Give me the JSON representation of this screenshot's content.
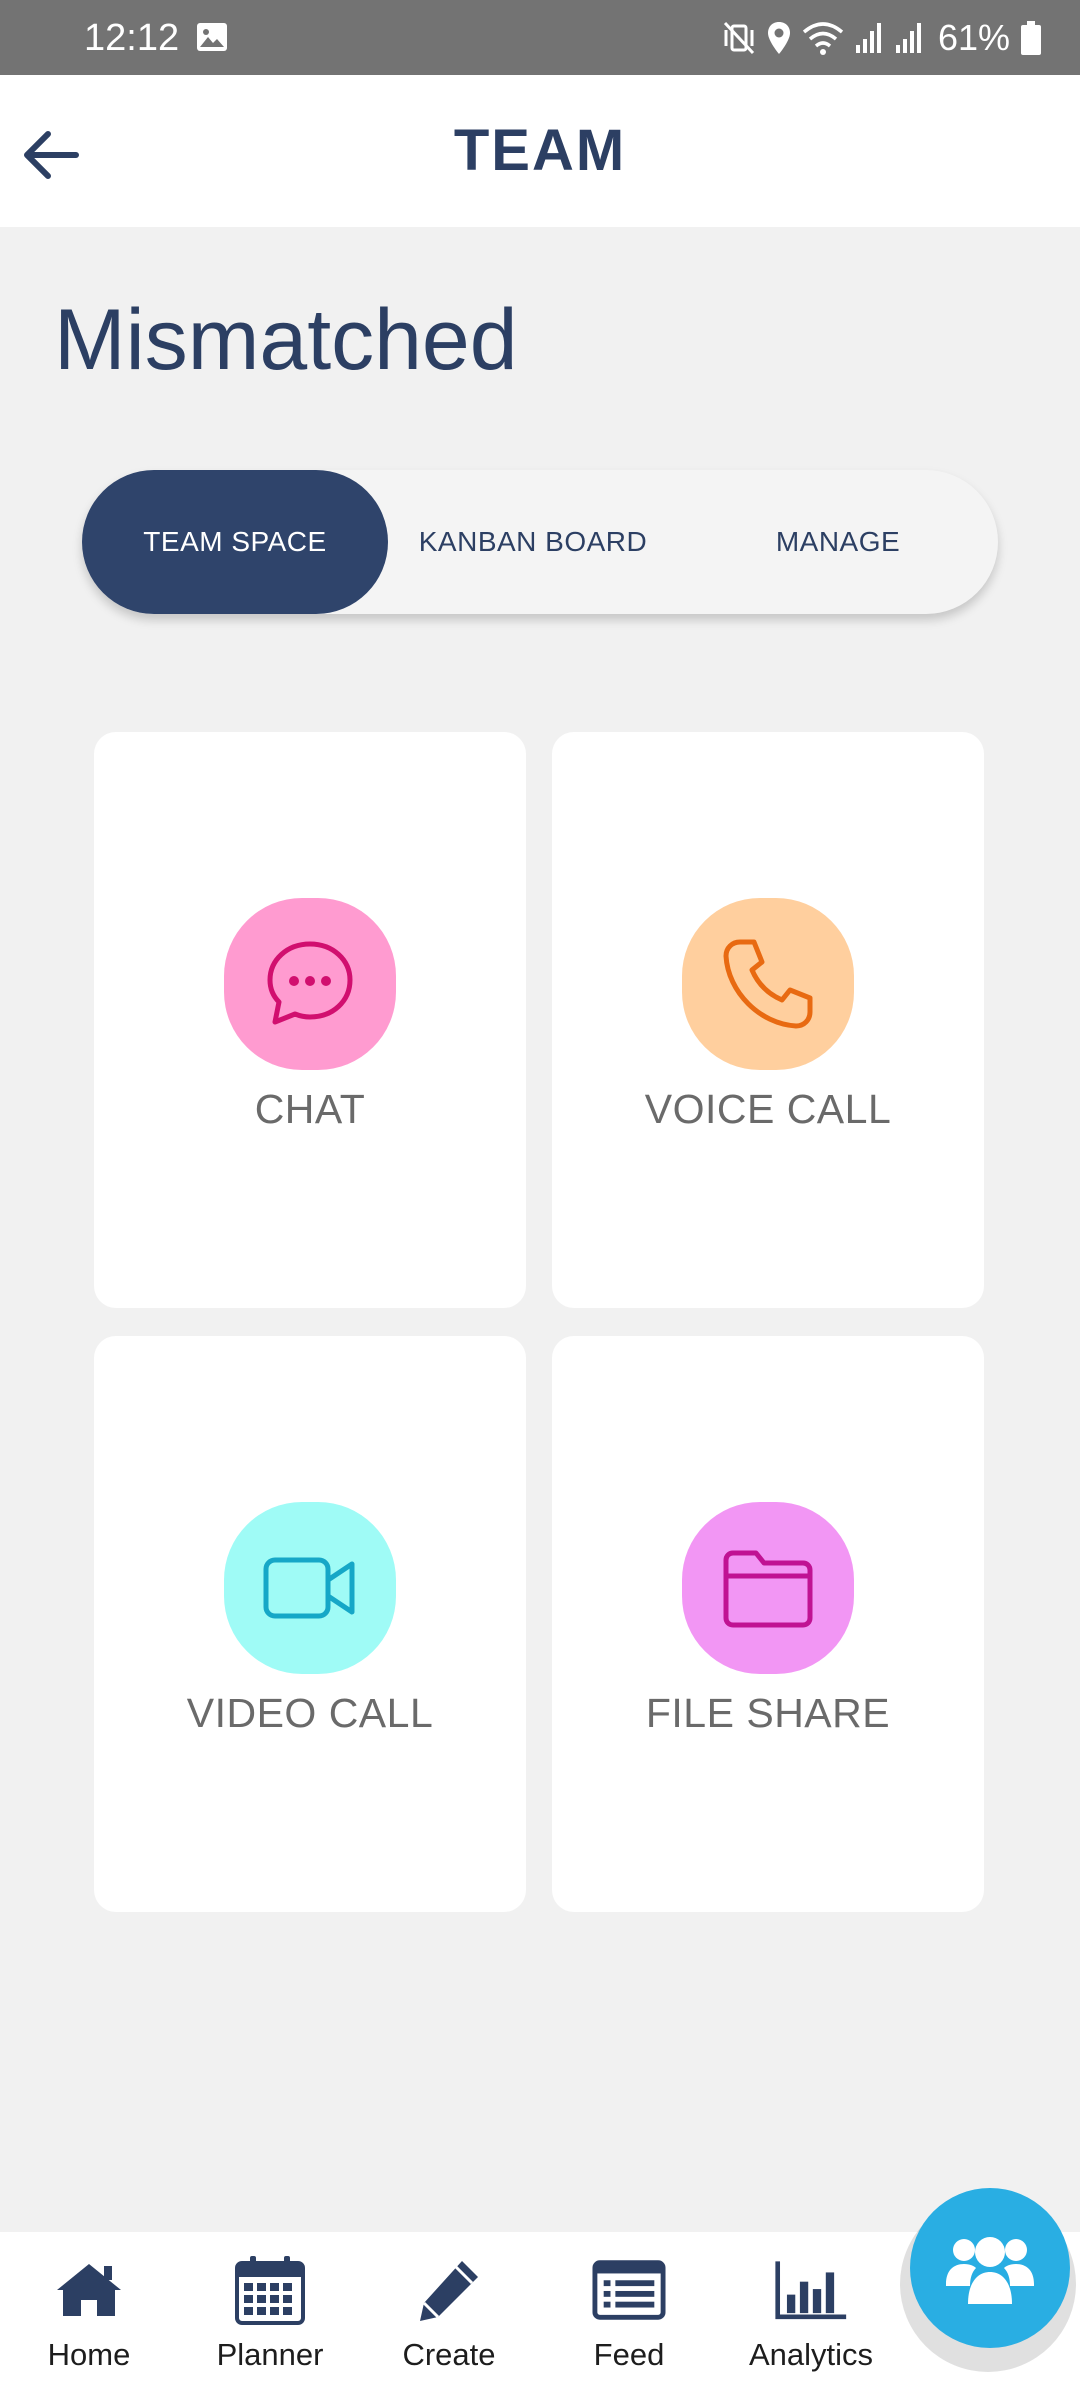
{
  "status_bar": {
    "time": "12:12",
    "battery": "61%"
  },
  "header": {
    "title": "TEAM"
  },
  "team": {
    "name": "Mismatched"
  },
  "tabs": [
    {
      "label": "TEAM SPACE",
      "active": true
    },
    {
      "label": "KANBAN BOARD",
      "active": false
    },
    {
      "label": "MANAGE",
      "active": false
    }
  ],
  "features": [
    {
      "label": "CHAT",
      "icon": "chat-bubble-icon",
      "bg": "#ff9bd0",
      "fg": "#d10f6f"
    },
    {
      "label": "VOICE CALL",
      "icon": "phone-icon",
      "bg": "#ffcf9e",
      "fg": "#e86a12"
    },
    {
      "label": "VIDEO CALL",
      "icon": "video-camera-icon",
      "bg": "#9ffbf6",
      "fg": "#16a7c7"
    },
    {
      "label": "FILE SHARE",
      "icon": "folder-icon",
      "bg": "#f296f4",
      "fg": "#c01293"
    }
  ],
  "bottom_nav": [
    {
      "label": "Home",
      "icon": "home-icon"
    },
    {
      "label": "Planner",
      "icon": "calendar-icon"
    },
    {
      "label": "Create",
      "icon": "pencil-icon"
    },
    {
      "label": "Feed",
      "icon": "feed-list-icon"
    },
    {
      "label": "Analytics",
      "icon": "bar-chart-icon"
    }
  ],
  "colors": {
    "primary": "#2f446b",
    "fab": "#29aee3",
    "background": "#f1f1f1"
  }
}
